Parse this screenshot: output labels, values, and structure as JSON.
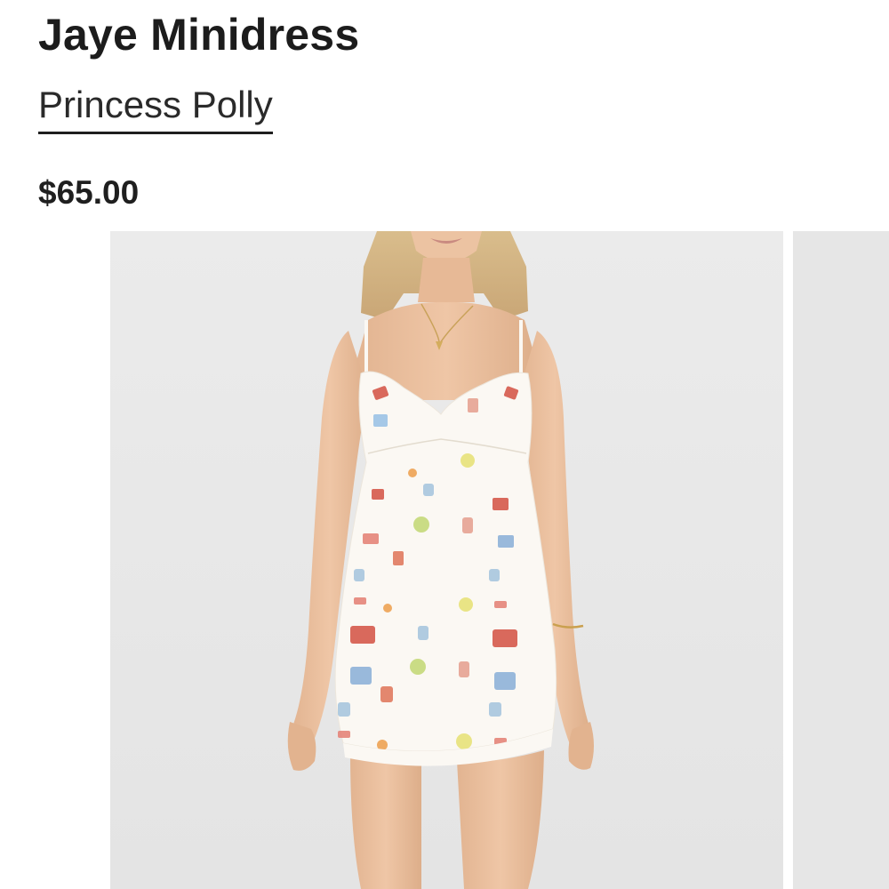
{
  "product": {
    "title": "Jaye Minidress",
    "brand": "Princess Polly",
    "price": "$65.00"
  },
  "gallery": {
    "main_image": "model-wearing-white-printed-minidress",
    "next_image": "next-product-photo-partial"
  },
  "colors": {
    "text": "#1c1c1c",
    "image_background": "#e8e8e8",
    "dress": "#fbf8f3"
  }
}
